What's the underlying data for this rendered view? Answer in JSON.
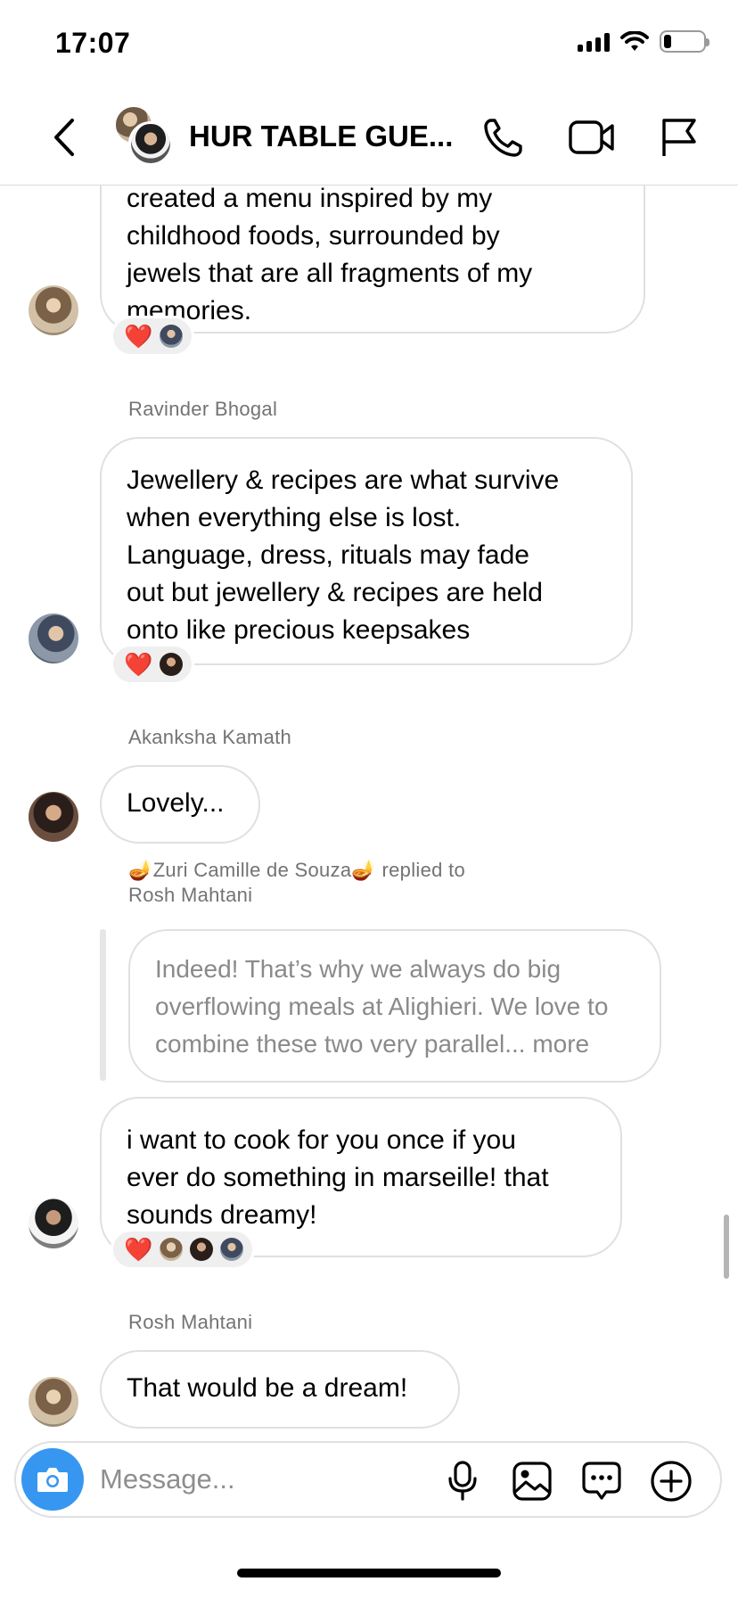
{
  "status_bar": {
    "time": "17:07",
    "battery_level": 0.2
  },
  "header": {
    "title": "HUR TABLE GUE...",
    "back_icon": "chevron-left-icon",
    "call_icon": "phone-icon",
    "video_icon": "video-camera-icon",
    "report_icon": "flag-icon"
  },
  "messages": [
    {
      "sender": "",
      "lines": [
        "created a menu inspired by my",
        "childhood foods, surrounded by",
        "jewels that are all fragments of my",
        "memories."
      ],
      "reactions": {
        "emoji": "❤️",
        "reactor_count": 1
      }
    },
    {
      "sender": "Ravinder Bhogal",
      "lines": [
        "Jewellery & recipes are what survive",
        "when everything else is lost.",
        "Language, dress, rituals may fade",
        "out but jewellery & recipes are held",
        "onto like precious keepsakes"
      ],
      "reactions": {
        "emoji": "❤️",
        "reactor_count": 1
      }
    },
    {
      "sender": "Akanksha Kamath",
      "lines": [
        "Lovely..."
      ]
    },
    {
      "reply_label_line1": "🪔Zuri Camille de Souza🪔 replied to",
      "reply_label_line2": "Rosh Mahtani",
      "quoted_lines": [
        "Indeed! That’s why we always do big",
        "overflowing meals at Alighieri. We love to",
        "combine these two very parallel..."
      ],
      "quoted_more": "more",
      "lines": [
        "i want to cook for you once if you",
        "ever do something in marseille! that",
        "sounds dreamy!"
      ],
      "reactions": {
        "emoji": "❤️",
        "reactor_count": 3
      }
    },
    {
      "sender": "Rosh Mahtani",
      "lines": [
        "That would be a dream!"
      ]
    }
  ],
  "composer": {
    "placeholder": "Message...",
    "camera_icon": "camera-icon",
    "mic_icon": "microphone-icon",
    "gallery_icon": "image-icon",
    "sticker_icon": "chat-bubble-icon",
    "add_icon": "plus-circle-icon"
  }
}
